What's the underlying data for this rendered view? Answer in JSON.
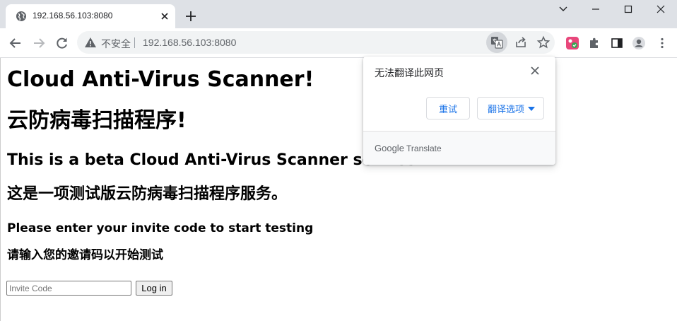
{
  "tab": {
    "title": "192.168.56.103:8080",
    "favicon": "globe-icon"
  },
  "toolbar": {
    "security_label": "不安全",
    "url": "192.168.56.103:8080"
  },
  "page": {
    "heading_en": "Cloud Anti-Virus Scanner!",
    "heading_zh": "云防病毒扫描程序!",
    "subheading_en": "This is a beta Cloud Anti-Virus Scanner service.",
    "subheading_zh": "这是一项测试版云防病毒扫描程序服务。",
    "prompt_en": "Please enter your invite code to start testing",
    "prompt_zh": "请输入您的邀请码以开始测试",
    "invite_placeholder": "Invite Code",
    "invite_value": "",
    "login_label": "Log in"
  },
  "translate_popup": {
    "title": "无法翻译此网页",
    "retry_label": "重试",
    "options_label": "翻译选项",
    "footer_brand_google": "Google",
    "footer_brand_translate": "Translate"
  },
  "colors": {
    "tabstrip_bg": "#dee1e6",
    "omnibox_bg": "#f1f3f4",
    "link_blue": "#1a73e8"
  }
}
